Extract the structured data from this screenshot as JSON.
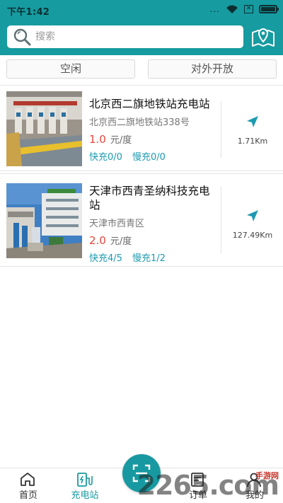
{
  "status_bar": {
    "time": "下午1:42",
    "dots": "...",
    "sim_icon": "sim-x-icon"
  },
  "search": {
    "placeholder": "搜索"
  },
  "filters": [
    {
      "label": "空闲"
    },
    {
      "label": "对外开放"
    }
  ],
  "stations": [
    {
      "name": "北京西二旗地铁站充电站",
      "address": "北京西二旗地铁站338号",
      "price": "1.0",
      "unit": "元/度",
      "fast": "快充0/0",
      "slow": "慢充0/0",
      "distance": "1.71Km"
    },
    {
      "name": "天津市西青圣纳科技充电站",
      "address": "天津市西青区",
      "price": "2.0",
      "unit": "元/度",
      "fast": "快充4/5",
      "slow": "慢充1/2",
      "distance": "127.49Km"
    }
  ],
  "tabs": [
    {
      "label": "首页",
      "icon": "home-icon"
    },
    {
      "label": "充电站",
      "icon": "charging-station-icon"
    },
    {
      "label": "订单",
      "icon": "order-icon"
    },
    {
      "label": "我的",
      "icon": "profile-icon"
    }
  ],
  "scan_icon": "scan-icon",
  "watermark": {
    "text": "2265.com",
    "sub": "手游网"
  },
  "colors": {
    "primary": "#169ba0",
    "price": "#e8453c",
    "slot": "#1b9bb0"
  },
  "battery_level": 1.0
}
